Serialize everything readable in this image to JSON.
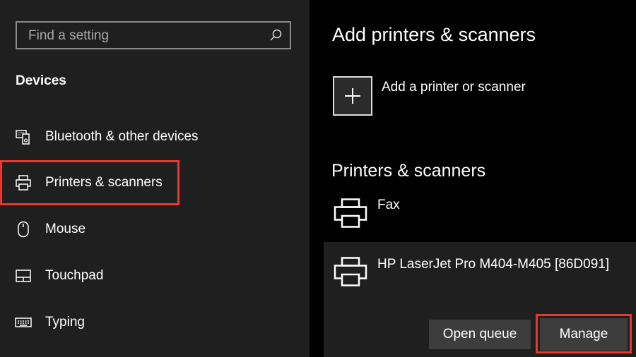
{
  "search": {
    "placeholder": "Find a setting"
  },
  "sidebar": {
    "section_title": "Devices",
    "items": [
      {
        "label": "Bluetooth & other devices",
        "icon": "bluetooth-devices-icon"
      },
      {
        "label": "Printers & scanners",
        "icon": "printer-icon",
        "selected": true
      },
      {
        "label": "Mouse",
        "icon": "mouse-icon"
      },
      {
        "label": "Touchpad",
        "icon": "touchpad-icon"
      },
      {
        "label": "Typing",
        "icon": "keyboard-icon"
      }
    ]
  },
  "main": {
    "title": "Add printers & scanners",
    "add_label": "Add a printer or scanner",
    "section_title": "Printers & scanners",
    "printers": [
      {
        "name": "Fax"
      },
      {
        "name": "HP LaserJet Pro M404-M405 [86D091]",
        "selected": true
      }
    ],
    "buttons": {
      "open_queue": "Open queue",
      "manage": "Manage"
    }
  },
  "colors": {
    "highlight": "#e53935",
    "sidebar_bg": "#1f1f1f",
    "button_bg": "#3d3d3d"
  }
}
